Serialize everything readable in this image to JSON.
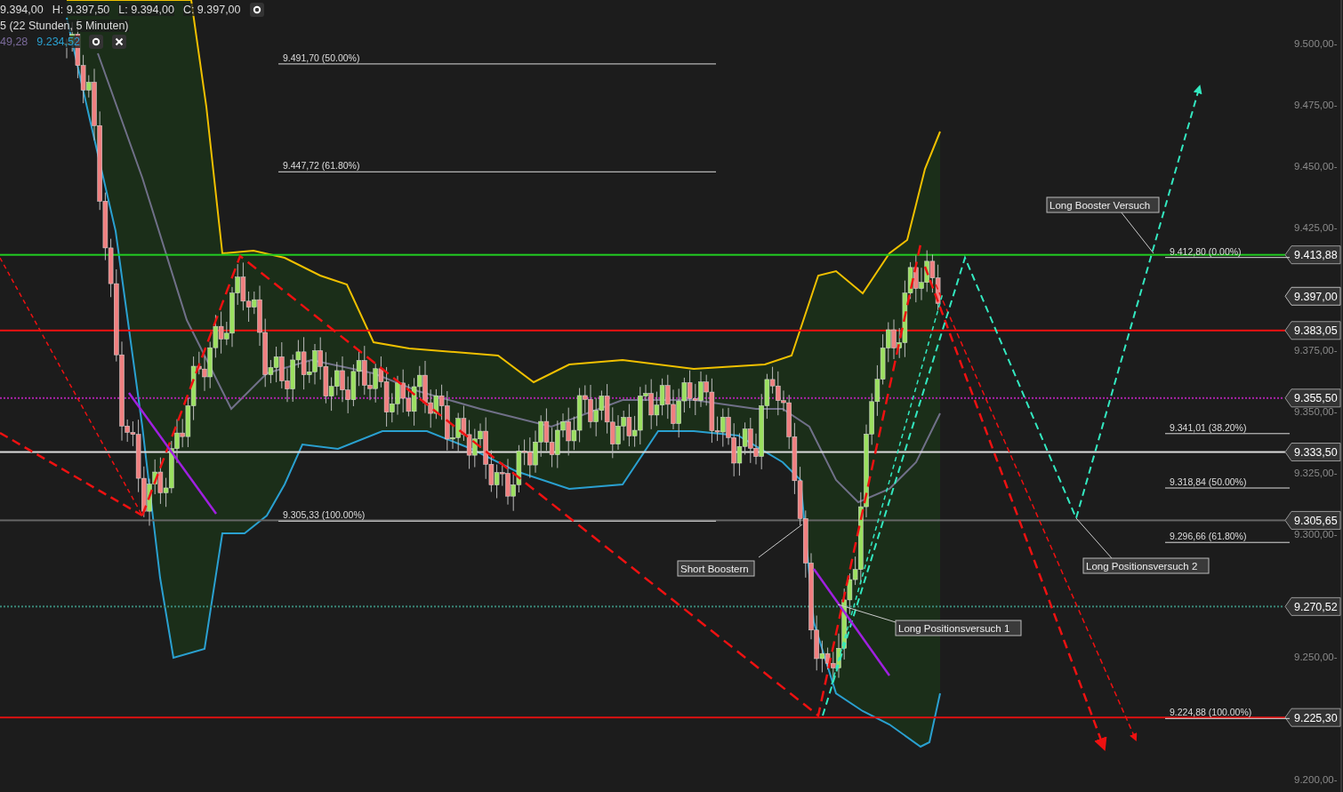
{
  "legend": {
    "ohlc": [
      "9.394,00",
      "H: 9.397,50",
      "L: 9.394,00",
      "C: 9.397,00"
    ],
    "period": "5 (22 Stunden, 5 Minuten)",
    "indicator_values": [
      {
        "value": "49,28",
        "color": "#7a6a9a"
      },
      {
        "value": "9.234,52",
        "color": "#2aa0d0"
      }
    ]
  },
  "y_axis": {
    "ticks": [
      "9.500,00-",
      "9.475,00-",
      "9.450,00-",
      "9.425,00-",
      "9.375,00-",
      "9.350,00-",
      "9.325,00-",
      "9.300,00-",
      "9.250,00-",
      "9.200,00-"
    ]
  },
  "price_levels": [
    {
      "tag": "9.413,88",
      "color": "#22cc22",
      "kind": "line"
    },
    {
      "tag": "9.397,00",
      "kind": "tag"
    },
    {
      "tag": "9.383,05",
      "color": "#ee1111",
      "kind": "line"
    },
    {
      "tag": "9.355,50",
      "color": "#aa22aa",
      "kind": "dotted"
    },
    {
      "tag": "9.333,50",
      "color": "#dddddd",
      "kind": "line"
    },
    {
      "tag": "9.305,65",
      "color": "#666666",
      "kind": "line"
    },
    {
      "tag": "9.270,52",
      "color": "#3a8a7a",
      "kind": "dotted"
    },
    {
      "tag": "9.225,30",
      "color": "#dd1111",
      "kind": "line"
    }
  ],
  "fibonacci": [
    {
      "levels": [
        "9.491,70 (50.00%)",
        "9.447,72 (61.80%)",
        "9.305,33 (100.00%)"
      ]
    },
    {
      "levels": [
        "9.412,80 (0.00%)",
        "9.341,01 (38.20%)",
        "9.318,84 (50.00%)",
        "9.296,66 (61.80%)",
        "9.224,88 (100.00%)"
      ]
    }
  ],
  "annotations": [
    "Long Booster Versuch",
    "Short Boostern",
    "Long Positionsversuch 1",
    "Long Positionsversuch 2"
  ]
}
